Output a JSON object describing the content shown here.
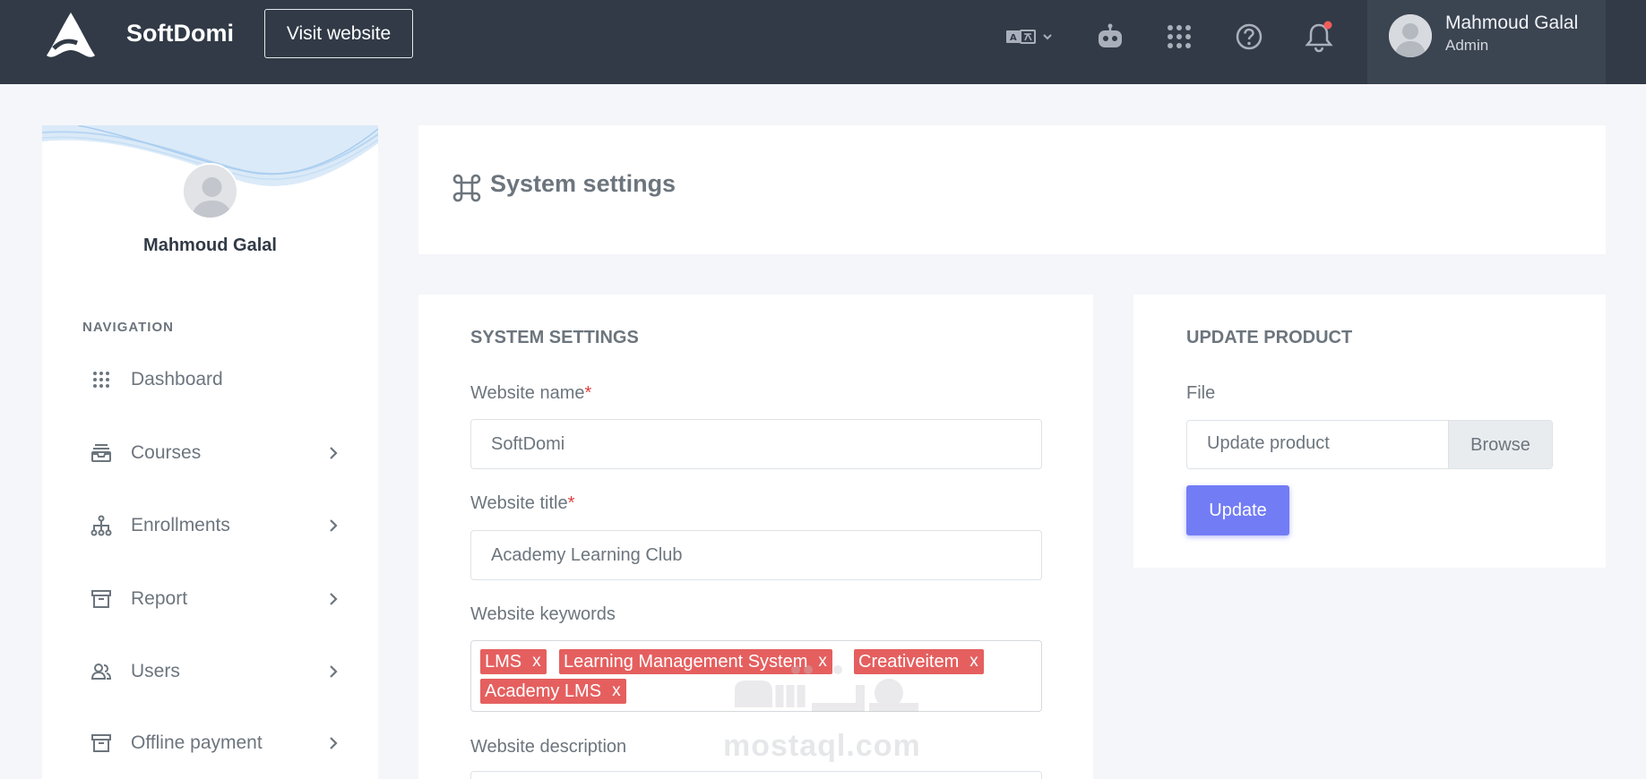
{
  "topbar": {
    "brand": "SoftDomi",
    "visit_button": "Visit website",
    "icons": [
      "logo-icon",
      "language-icon",
      "robot-icon",
      "apps-grid-icon",
      "help-icon",
      "bell-icon"
    ],
    "notification_dot_color": "#f25c5c",
    "user": {
      "name": "Mahmoud Galal",
      "role": "Admin"
    }
  },
  "sidebar": {
    "user_name": "Mahmoud Galal",
    "nav_title": "NAVIGATION",
    "items": [
      {
        "label": "Dashboard",
        "icon": "dots-grid-icon",
        "has_chevron": false
      },
      {
        "label": "Courses",
        "icon": "inbox-stack-icon",
        "has_chevron": true
      },
      {
        "label": "Enrollments",
        "icon": "sitemap-icon",
        "has_chevron": true
      },
      {
        "label": "Report",
        "icon": "archive-icon",
        "has_chevron": true
      },
      {
        "label": "Users",
        "icon": "users-icon",
        "has_chevron": true
      },
      {
        "label": "Offline payment",
        "icon": "archive-icon",
        "has_chevron": true
      }
    ]
  },
  "page": {
    "title": "System settings",
    "title_icon": "command-icon"
  },
  "settings_form": {
    "heading": "SYSTEM SETTINGS",
    "website_name": {
      "label": "Website name",
      "required_mark": "*",
      "value": "SoftDomi"
    },
    "website_title": {
      "label": "Website title",
      "required_mark": "*",
      "value": "Academy Learning Club"
    },
    "website_keywords": {
      "label": "Website keywords",
      "tags": [
        "LMS",
        "Learning Management System",
        "Creativeitem",
        "Academy LMS"
      ],
      "tag_remove": "x",
      "tag_color": "#e55f5f"
    },
    "website_description": {
      "label": "Website description"
    }
  },
  "update_product": {
    "heading": "UPDATE PRODUCT",
    "file_label": "File",
    "file_placeholder": "Update product",
    "browse_label": "Browse",
    "update_button": "Update",
    "accent_color": "#727cf5"
  },
  "watermark": {
    "latin": "mostaql.com"
  }
}
